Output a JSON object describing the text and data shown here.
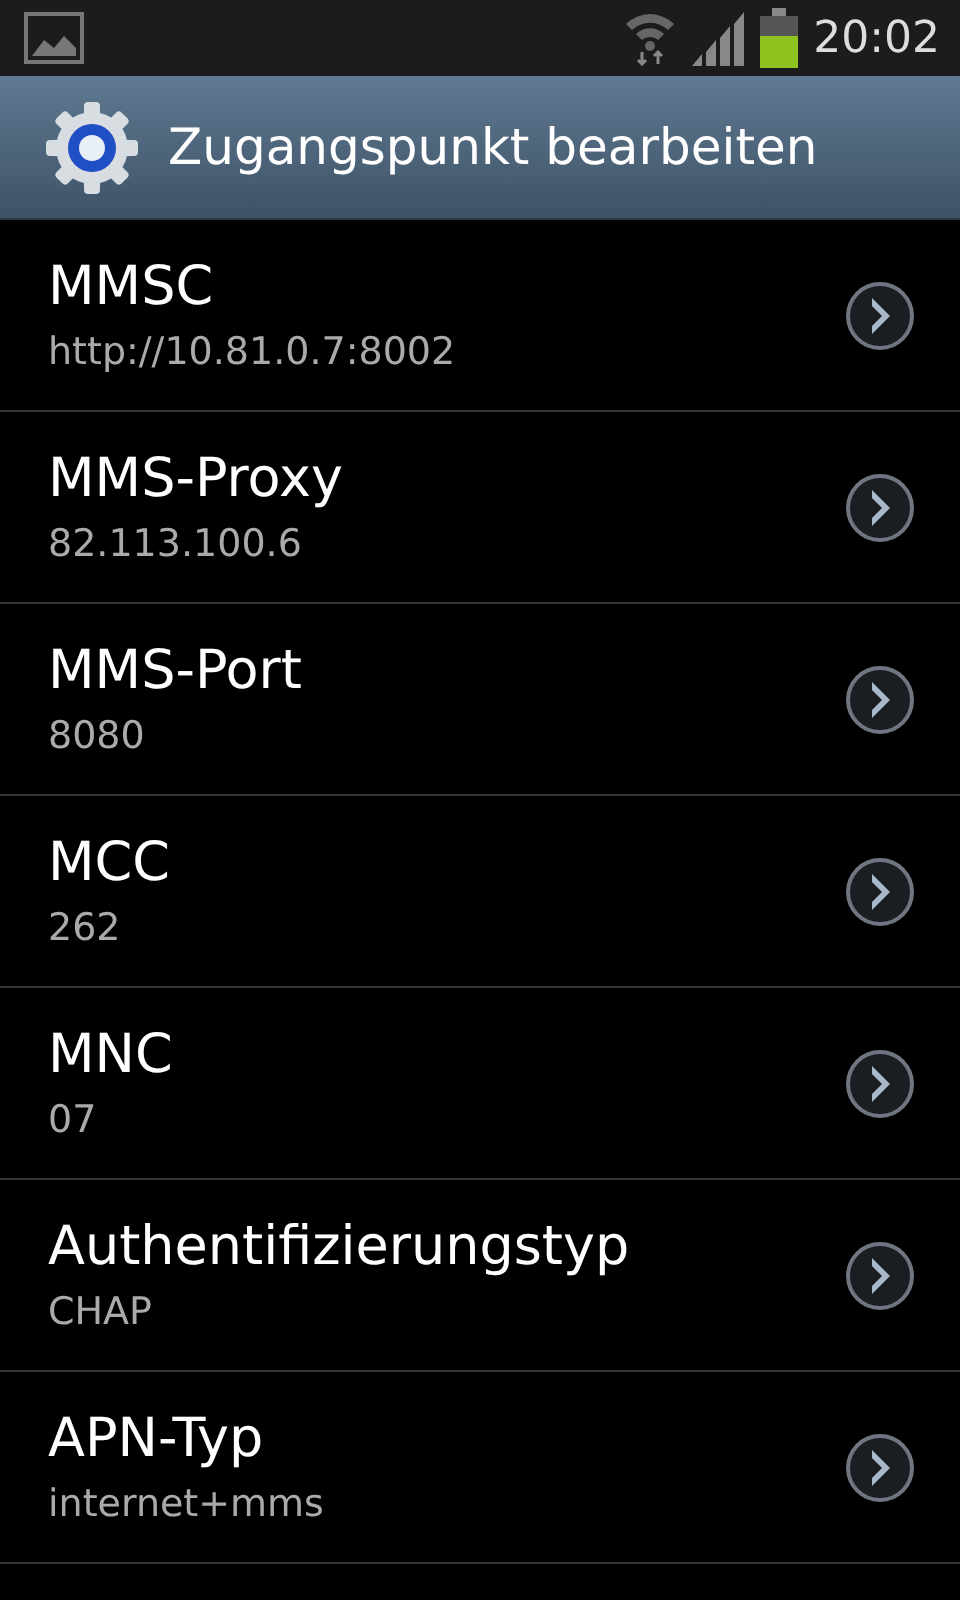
{
  "status_bar": {
    "time": "20:02"
  },
  "header": {
    "title": "Zugangspunkt bearbeiten"
  },
  "settings": [
    {
      "label": "MMSC",
      "value": "http://10.81.0.7:8002"
    },
    {
      "label": "MMS-Proxy",
      "value": "82.113.100.6"
    },
    {
      "label": "MMS-Port",
      "value": "8080"
    },
    {
      "label": "MCC",
      "value": "262"
    },
    {
      "label": "MNC",
      "value": "07"
    },
    {
      "label": "Authentifizierungstyp",
      "value": "CHAP"
    },
    {
      "label": "APN-Typ",
      "value": "internet+mms"
    }
  ]
}
